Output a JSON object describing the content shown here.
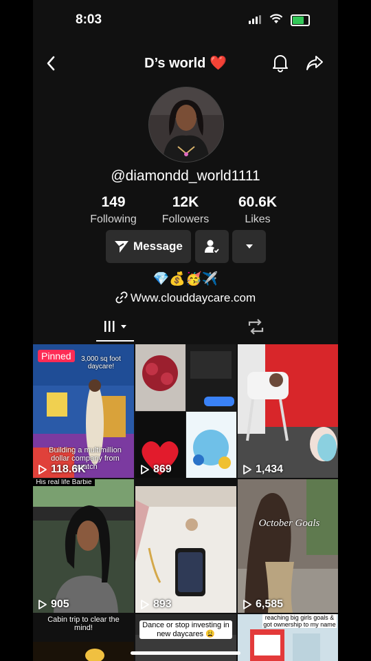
{
  "status_bar": {
    "time": "8:03"
  },
  "header": {
    "title": "D’s world ❤️"
  },
  "profile": {
    "handle": "@diamondd_world1111",
    "stats": [
      {
        "value": "149",
        "label": "Following"
      },
      {
        "value": "12K",
        "label": "Followers"
      },
      {
        "value": "60.6K",
        "label": "Likes"
      }
    ],
    "message_label": "Message",
    "bio": "💎💰🥳✈️",
    "link": "Www.clouddaycare.com"
  },
  "videos": [
    {
      "views": "118.6K",
      "pinned": "Pinned",
      "caption_top": "3,000 sq foot daycare!",
      "caption_bottom": "Building a multimillion dollar company from scratch"
    },
    {
      "views": "869"
    },
    {
      "views": "1,434"
    },
    {
      "views": "905",
      "caption_top": "His real life Barbie"
    },
    {
      "views": "893"
    },
    {
      "views": "6,585",
      "caption_overlay": "October Goals"
    },
    {
      "caption_top": "Cabin trip to clear the mind!"
    },
    {
      "caption_top": "Dance or stop investing in new daycares 😩"
    },
    {
      "caption_top": "reaching big girls goals & got ownership to my name"
    }
  ],
  "colors": {
    "background": "#111111",
    "button": "#2d2d2d",
    "pinned": "#fe2c55",
    "battery": "#34c759"
  }
}
